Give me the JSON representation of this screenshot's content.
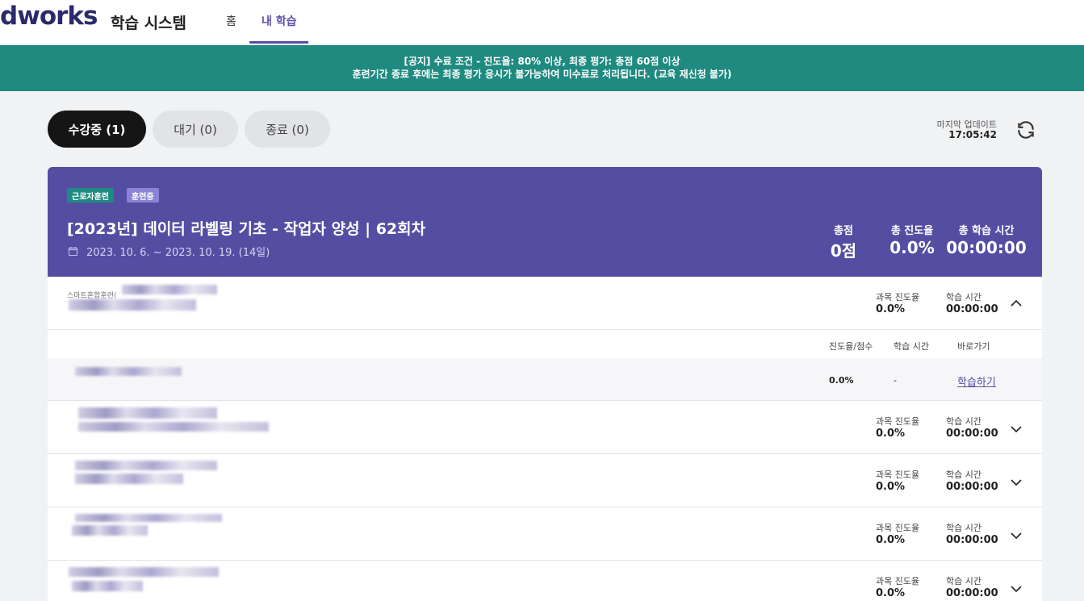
{
  "header": {
    "logo": "dworks",
    "system_title": "학습 시스템",
    "nav": [
      {
        "label": "홈",
        "active": false
      },
      {
        "label": "내 학습",
        "active": true
      }
    ]
  },
  "notice": {
    "line1": "[공지] 수료 조건 - 진도율: 80% 이상, 최종 평가: 총점 60점 이상",
    "line2": "훈련기간 종료 후에는 최종 평가 응시가 불가능하여 미수료로 처리됩니다. (교육 재신청 불가)"
  },
  "tabs": [
    {
      "label": "수강중 (1)",
      "active": true
    },
    {
      "label": "대기 (0)",
      "active": false
    },
    {
      "label": "종료 (0)",
      "active": false
    }
  ],
  "update": {
    "label": "마지막 업데이트",
    "time": "17:05:42"
  },
  "course": {
    "badges": [
      "근로자훈련",
      "훈련중"
    ],
    "title": "[2023년] 데이터 라벨링 기초 - 작업자 양성 | 62회차",
    "date": "2023. 10. 6. ~ 2023. 10. 19. (14일)",
    "stats": {
      "score_label": "총점",
      "score_value": "0점",
      "progress_label": "총 진도율",
      "progress_value": "0.0%",
      "time_label": "총 학습 시간",
      "time_value": "00:00:00"
    }
  },
  "subjects": {
    "first_category": "스마트혼합훈련(",
    "progress_label": "과목 진도율",
    "time_label": "학습 시간",
    "rows": [
      {
        "progress": "0.0%",
        "time": "00:00:00",
        "expanded": true
      },
      {
        "progress": "0.0%",
        "time": "00:00:00",
        "expanded": false
      },
      {
        "progress": "0.0%",
        "time": "00:00:00",
        "expanded": false
      },
      {
        "progress": "0.0%",
        "time": "00:00:00",
        "expanded": false
      },
      {
        "progress": "0.0%",
        "time": "00:00:00",
        "expanded": false
      }
    ]
  },
  "lesson_table": {
    "headers": [
      "진도율/점수",
      "학습 시간",
      "바로가기"
    ],
    "row": {
      "progress": "0.0%",
      "time": "-",
      "action": "학습하기"
    }
  },
  "colors": {
    "brand": "#544ea3",
    "notice": "#1f8a80",
    "logo": "#2b2a6b"
  }
}
